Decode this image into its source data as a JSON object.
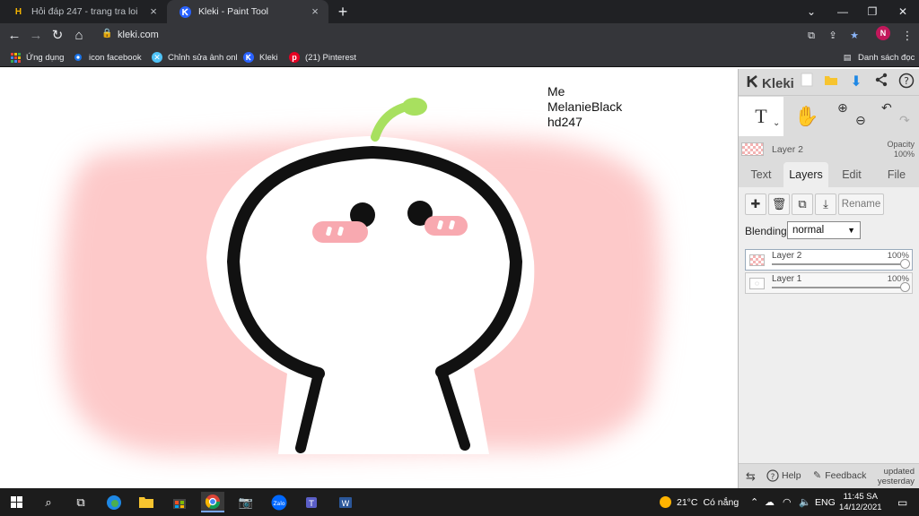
{
  "browser": {
    "tabs": [
      {
        "title": "Hỏi đáp 247 - trang tra loi",
        "favicon": "H"
      },
      {
        "title": "Kleki - Paint Tool",
        "favicon": "K"
      }
    ],
    "url": "kleki.com",
    "profile_initial": "N",
    "reading_list": "Danh sách đọc",
    "bookmarks": [
      {
        "label": "Ứng dụng"
      },
      {
        "label": "icon facebook"
      },
      {
        "label": "Chỉnh sửa ảnh onl"
      },
      {
        "label": "Kleki"
      },
      {
        "label": "(21) Pinterest"
      }
    ]
  },
  "canvas": {
    "text_lines": [
      "Me",
      "MelanieBlack",
      "hd247"
    ],
    "colors": {
      "blush_bg": "#fdc9c9",
      "outline": "#111111",
      "sprout": "#a8e05f",
      "cheeks": "#f8a9b0"
    }
  },
  "kleki": {
    "logo": "Kleki",
    "current_layer": "Layer 2",
    "opacity_label": "Opacity",
    "opacity_value": "100%",
    "text_tool_glyph": "T",
    "tabs": [
      "Text",
      "Layers",
      "Edit",
      "File"
    ],
    "active_tab": "Layers",
    "rename_label": "Rename",
    "blending_label": "Blending",
    "blending_value": "normal",
    "layers": [
      {
        "name": "Layer 2",
        "opacity": "100%",
        "opacity_fraction": 1.0
      },
      {
        "name": "Layer 1",
        "opacity": "100%",
        "opacity_fraction": 1.0
      }
    ],
    "bottom": {
      "help": "Help",
      "feedback": "Feedback",
      "updated_1": "updated",
      "updated_2": "yesterday"
    }
  },
  "taskbar": {
    "weather_temp": "21°C",
    "weather_text": "Có nắng",
    "language": "ENG",
    "time": "11:45 SA",
    "date": "14/12/2021"
  }
}
